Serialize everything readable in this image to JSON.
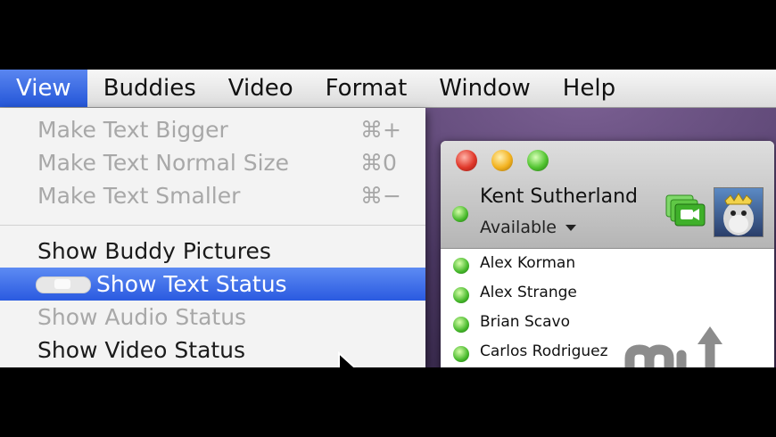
{
  "menubar": {
    "items": [
      "View",
      "Buddies",
      "Video",
      "Format",
      "Window",
      "Help"
    ],
    "active": "View"
  },
  "view_menu": {
    "items": [
      {
        "label": "Make Text Bigger",
        "shortcut": "⌘+",
        "enabled": false
      },
      {
        "label": "Make Text Normal Size",
        "shortcut": "⌘0",
        "enabled": false
      },
      {
        "label": "Make Text Smaller",
        "shortcut": "⌘−",
        "enabled": false
      },
      {
        "label": "Show Buddy Pictures",
        "shortcut": "",
        "enabled": true
      },
      {
        "label": "Show Text Status",
        "shortcut": "",
        "enabled": true,
        "selected": true
      },
      {
        "label": "Show Audio Status",
        "shortcut": "",
        "enabled": false
      },
      {
        "label": "Show Video Status",
        "shortcut": "",
        "enabled": true
      }
    ]
  },
  "buddy_window": {
    "user_name": "Kent Sutherland",
    "status": "Available",
    "buddies": [
      "Alex Korman",
      "Alex Strange",
      "Brian Scavo",
      "Carlos Rodriguez"
    ]
  },
  "colors": {
    "menu_highlight": "#2a5ae0",
    "status_green": "#45b82a",
    "desktop": "#4e3a66"
  }
}
